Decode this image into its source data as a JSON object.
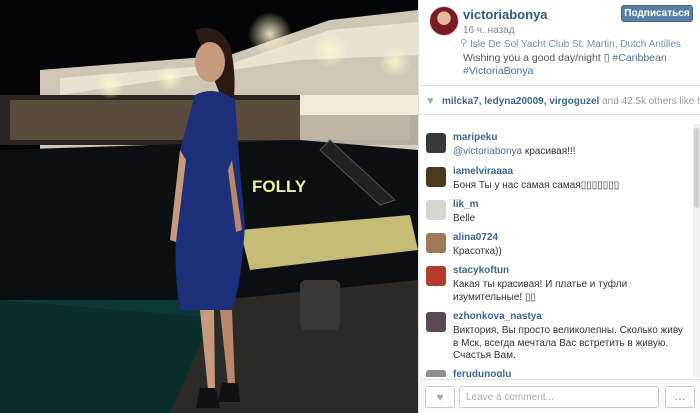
{
  "post": {
    "username": "victoriabonya",
    "follow_label": "Подписаться",
    "time": "16 ч. назад",
    "location": "Isle De Sol Yacht Club St. Martin, Dutch Antilles",
    "caption_text": "Wishing you a good day/night ",
    "caption_emoji": "▯",
    "caption_tags": "#Caribbean #VictoriaBonya",
    "photo_sign": "FOLLY",
    "photo_alt": "woman-in-blue-dress-by-yacht"
  },
  "likes": {
    "users": "milcka7, ledyna20009, virgoguzel",
    "and": " and ",
    "count": "42.5k",
    "suffix": " others like this"
  },
  "comments": [
    {
      "user": "maripeku",
      "mention": "@victoriabonya",
      "text": " красивая!!!",
      "avatar": "#3a3a3a"
    },
    {
      "user": "iamelviraaaa",
      "mention": "",
      "text": "Боня Ты у нас самая самая▯▯▯▯▯▯▯",
      "avatar": "#4b3b1c"
    },
    {
      "user": "lik_m",
      "mention": "",
      "text": "Belle",
      "avatar": "#d8d4d0"
    },
    {
      "user": "alina0724",
      "mention": "",
      "text": "Красотка))",
      "avatar": "#a07a56"
    },
    {
      "user": "stacykoftun",
      "mention": "",
      "text": "Какая ты красивая! И платье и туфли изумительные! ▯▯",
      "avatar": "#b63a2e"
    },
    {
      "user": "ezhonkova_nastya",
      "mention": "",
      "text": "Виктория, Вы просто великолепны. Сколько живу в Мск, всегда мечтала Вас встретить в живую. Счастья Вам.",
      "avatar": "#5a4a55"
    },
    {
      "user": "ferudunoglu",
      "mention": "",
      "text": "",
      "avatar": "#8c8f96"
    }
  ],
  "footer": {
    "heart_glyph": "♥",
    "comment_placeholder": "Leave a comment...",
    "more_glyph": "…"
  },
  "icons": [
    "location-pin-icon",
    "heart-icon",
    "more-options-icon"
  ]
}
